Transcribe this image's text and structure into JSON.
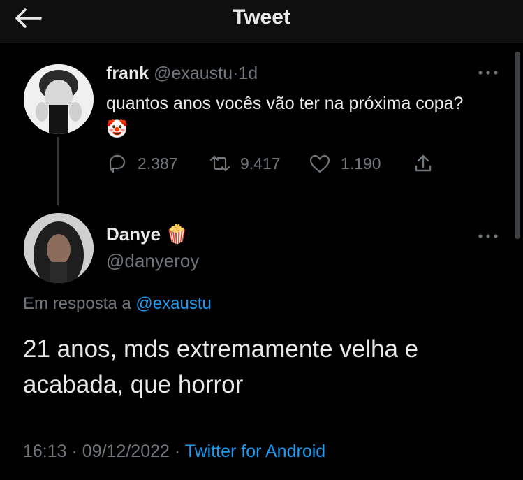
{
  "header": {
    "title": "Tweet"
  },
  "original_tweet": {
    "name": "frank",
    "handle": "@exaustu",
    "separator": "·",
    "age": "1d",
    "text": "quantos anos vocês vão ter na próxima copa? 🤡",
    "replies": "2.387",
    "retweets": "9.417",
    "likes": "1.190"
  },
  "reply_tweet": {
    "name": "Danye 🍿",
    "handle": "@danyeroy",
    "replying_prefix": "Em resposta a",
    "replying_to": "@exaustu",
    "text": "21 anos, mds extremamente velha e acabada, que horror",
    "time": "16:13",
    "date_sep": "·",
    "date": "09/12/2022",
    "client_sep": "·",
    "client": "Twitter for Android"
  },
  "colors": {
    "background": "#000000",
    "link": "#1d9bf0",
    "muted": "#71767b"
  },
  "icons": [
    "back-arrow-icon",
    "more-icon",
    "reply-icon",
    "retweet-icon",
    "like-icon",
    "share-icon"
  ]
}
